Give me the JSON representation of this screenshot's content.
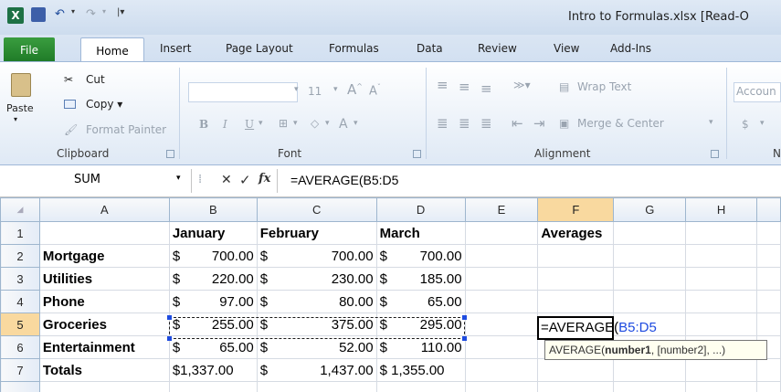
{
  "window": {
    "title": "Intro to Formulas.xlsx  [Read-O"
  },
  "tabs": [
    "File",
    "Home",
    "Insert",
    "Page Layout",
    "Formulas",
    "Data",
    "Review",
    "View",
    "Add-Ins"
  ],
  "ribbon": {
    "clipboard": {
      "paste": "Paste",
      "cut": "Cut",
      "copy": "Copy ▾",
      "format_painter": "Format Painter",
      "label": "Clipboard"
    },
    "font": {
      "size": "11",
      "label": "Font",
      "bold": "B",
      "italic": "I",
      "underline": "U"
    },
    "alignment": {
      "wrap_text": "Wrap Text",
      "merge_center": "Merge & Center",
      "label": "Alignment"
    },
    "number": {
      "format": "Accoun",
      "currency": "$",
      "label": "N"
    }
  },
  "formula_bar": {
    "name_box": "SUM",
    "formula": "=AVERAGE(B5:D5"
  },
  "grid": {
    "columns": [
      "A",
      "B",
      "C",
      "D",
      "E",
      "F",
      "G",
      "H"
    ],
    "rows": [
      {
        "n": "1",
        "a": "",
        "b1": "January",
        "b2": "",
        "c1": "February",
        "c2": "",
        "d1": "March",
        "d2": "",
        "f": "Averages"
      },
      {
        "n": "2",
        "a": "Mortgage",
        "b1": "$",
        "b2": "700.00",
        "c1": "$",
        "c2": "700.00",
        "d1": "$",
        "d2": "700.00",
        "f": ""
      },
      {
        "n": "3",
        "a": "Utilities",
        "b1": "$",
        "b2": "220.00",
        "c1": "$",
        "c2": "230.00",
        "d1": "$",
        "d2": "185.00",
        "f": ""
      },
      {
        "n": "4",
        "a": "Phone",
        "b1": "$",
        "b2": "97.00",
        "c1": "$",
        "c2": "80.00",
        "d1": "$",
        "d2": "65.00",
        "f": ""
      },
      {
        "n": "5",
        "a": "Groceries",
        "b1": "$",
        "b2": "255.00",
        "c1": "$",
        "c2": "375.00",
        "d1": "$",
        "d2": "295.00",
        "f": ""
      },
      {
        "n": "6",
        "a": "Entertainment",
        "b1": "$",
        "b2": "65.00",
        "c1": "$",
        "c2": "52.00",
        "d1": "$",
        "d2": "110.00",
        "f": ""
      },
      {
        "n": "7",
        "a": "Totals",
        "b1": "$1,337.00",
        "b2": "",
        "c1": "$",
        "c2": "1,437.00",
        "d1": "$ 1,355.00",
        "d2": "",
        "f": ""
      }
    ],
    "active_cell_formula_prefix": "=AVERAGE(",
    "active_cell_formula_ref": "B5:D5",
    "tooltip_fn": "AVERAGE(",
    "tooltip_arg1": "number1",
    "tooltip_rest": ", [number2], ...)"
  },
  "colors": {
    "ref_blue": "#1e4be0",
    "selected_header": "#f9d99f",
    "file_tab": "#2a8a33"
  }
}
